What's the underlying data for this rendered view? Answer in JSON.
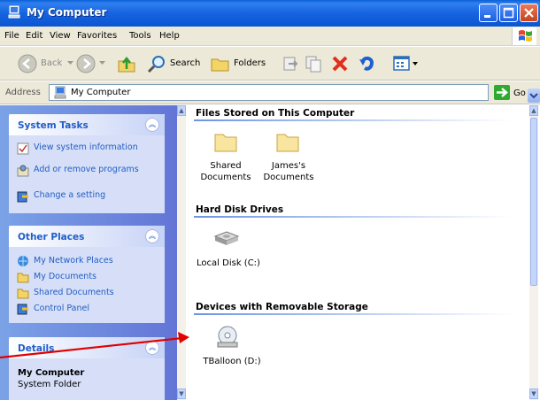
{
  "window": {
    "title": "My Computer",
    "buttons": {
      "minimize": "minimize-icon",
      "maximize": "maximize-icon",
      "close": "close-icon"
    }
  },
  "menu": [
    "File",
    "Edit",
    "View",
    "Favorites",
    "Tools",
    "Help"
  ],
  "toolbar": {
    "back": "Back",
    "search": "Search",
    "folders": "Folders"
  },
  "address": {
    "label": "Address",
    "value": "My Computer",
    "go": "Go"
  },
  "tasks_panel": {
    "title": "System Tasks",
    "items": [
      "View system information",
      "Add or remove programs",
      "Change a setting"
    ]
  },
  "places_panel": {
    "title": "Other Places",
    "items": [
      "My Network Places",
      "My Documents",
      "Shared Documents",
      "Control Panel"
    ]
  },
  "details_panel": {
    "title": "Details",
    "name": "My Computer",
    "type": "System Folder"
  },
  "groups": [
    {
      "title": "Files Stored on This Computer",
      "items": [
        "Shared Documents",
        "James's Documents"
      ]
    },
    {
      "title": "Hard Disk Drives",
      "items": [
        "Local Disk (C:)"
      ]
    },
    {
      "title": "Devices with Removable Storage",
      "items": [
        "TBalloon (D:)"
      ]
    }
  ],
  "colors": {
    "title_bar": "#1663e0",
    "task_pane": "#6375d6",
    "link": "#215dc6",
    "annotation_arrow": "#e00000"
  }
}
